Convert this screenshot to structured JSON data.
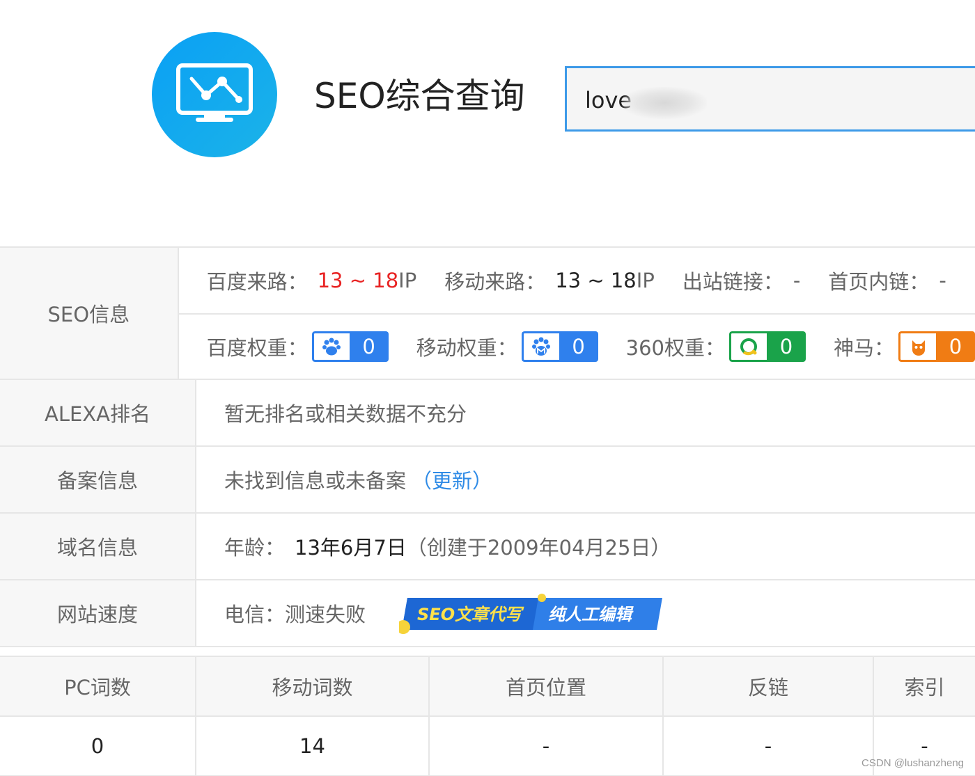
{
  "header": {
    "logo_icon": "monitor-chart-icon",
    "title": "SEO综合查询",
    "search_value": "love",
    "accent_color": "#3d9ae8"
  },
  "seo_info": {
    "label": "SEO信息",
    "baidu_traffic_label": "百度来路：",
    "baidu_traffic_value": "13 ~ 18",
    "ip_unit": " IP",
    "mobile_traffic_label": "移动来路：",
    "mobile_traffic_value": "13 ~ 18",
    "outbound_label": "出站链接：",
    "outbound_value": "-",
    "home_inlinks_label": "首页内链：",
    "home_inlinks_value": "-",
    "baidu_weight_label": "百度权重：",
    "baidu_weight_value": "0",
    "mobile_weight_label": "移动权重：",
    "mobile_weight_value": "0",
    "weight_360_label": "360权重：",
    "weight_360_value": "0",
    "shenma_label": "神马：",
    "shenma_value": "0"
  },
  "alexa": {
    "label": "ALEXA排名",
    "value": "暂无排名或相关数据不充分"
  },
  "icp": {
    "label": "备案信息",
    "value": "未找到信息或未备案",
    "link": "（更新）"
  },
  "domain": {
    "label": "域名信息",
    "age_label": "年龄：",
    "age_value": "13年6月7日",
    "created": "（创建于2009年04月25日）"
  },
  "speed": {
    "label": "网站速度",
    "value": "电信：测速失败",
    "ad_text_1": "SEO文章代写",
    "ad_text_2": "纯人工编辑"
  },
  "words": {
    "headers": [
      "PC词数",
      "移动词数",
      "首页位置",
      "反链",
      "索引"
    ],
    "values": [
      "0",
      "14",
      "-",
      "-",
      "-"
    ]
  },
  "watermark": "CSDN @lushanzheng"
}
